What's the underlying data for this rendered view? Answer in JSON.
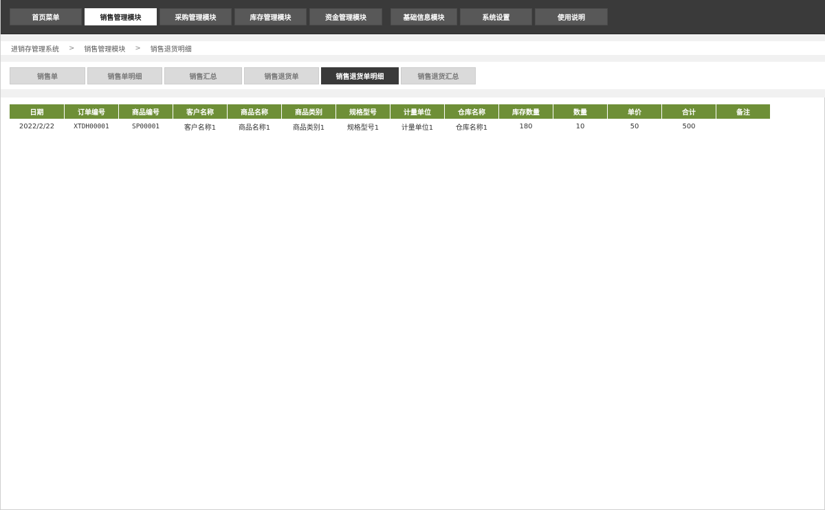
{
  "top_nav": {
    "items": [
      {
        "label": "首页菜单",
        "active": false
      },
      {
        "label": "销售管理模块",
        "active": true
      },
      {
        "label": "采购管理模块",
        "active": false
      },
      {
        "label": "库存管理模块",
        "active": false
      },
      {
        "label": "资金管理模块",
        "active": false
      },
      {
        "label": "基础信息模块",
        "active": false
      },
      {
        "label": "系统设置",
        "active": false
      },
      {
        "label": "使用说明",
        "active": false
      }
    ]
  },
  "breadcrumb": {
    "items": [
      "进销存管理系统",
      "销售管理模块",
      "销售退货明细"
    ],
    "separator": ">"
  },
  "sub_nav": {
    "items": [
      {
        "label": "销售单",
        "active": false
      },
      {
        "label": "销售单明细",
        "active": false
      },
      {
        "label": "销售汇总",
        "active": false
      },
      {
        "label": "销售退货单",
        "active": false
      },
      {
        "label": "销售退货单明细",
        "active": true
      },
      {
        "label": "销售退货汇总",
        "active": false
      }
    ]
  },
  "table": {
    "headers": [
      "日期",
      "订单编号",
      "商品编号",
      "客户名称",
      "商品名称",
      "商品类别",
      "规格型号",
      "计量单位",
      "仓库名称",
      "库存数量",
      "数量",
      "单价",
      "合计",
      "备注"
    ],
    "rows": [
      [
        "2022/2/22",
        "XTDH00001",
        "SP00001",
        "客户名称1",
        "商品名称1",
        "商品类别1",
        "规格型号1",
        "计量单位1",
        "仓库名称1",
        "180",
        "10",
        "50",
        "500",
        ""
      ]
    ]
  },
  "colors": {
    "topbar_bg": "#3a3a3a",
    "topnav_item_bg": "#585858",
    "header_green": "#6e8f37",
    "subnav_inactive_bg": "#dadada",
    "subnav_active_bg": "#3a3a3a"
  }
}
